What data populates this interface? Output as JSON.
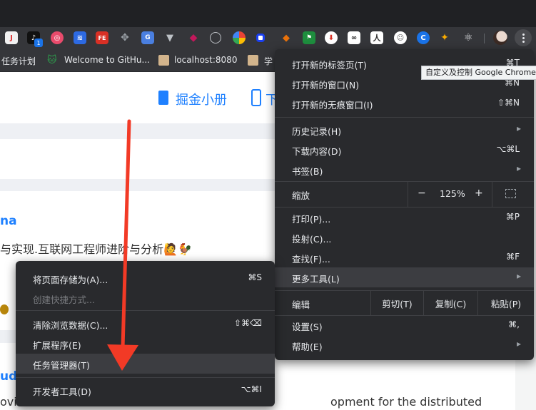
{
  "extensions": {
    "badge": "1",
    "icons": [
      "j-icon",
      "tiktok-icon",
      "pink-circle-icon",
      "layers-icon",
      "fe-icon",
      "move-icon",
      "translate-icon",
      "vue-icon",
      "diamond-icon",
      "speedometer-icon",
      "colorful-ball-icon",
      "blue-square-icon",
      "orange-icon",
      "green-flag-icon",
      "download-icon",
      "glasses-icon",
      "person-icon",
      "ghost-icon",
      "blue-c-icon",
      "dog-icon",
      "react-icon"
    ]
  },
  "bookmarks": {
    "items": [
      {
        "label": "任务计划"
      },
      {
        "label": "Welcome to GitHu..."
      },
      {
        "label": "localhost:8080"
      },
      {
        "label": "学"
      }
    ]
  },
  "page": {
    "header_link": "掘金小册",
    "header_link2": "下",
    "article_title_fragment": "na",
    "article_body_fragment": "与实现.互联网工程师进阶与分析🙋🐓",
    "article2_title_fragment": "ud-",
    "article2_body_fragment": "ovid",
    "article2_body_right": "opment for the distributed"
  },
  "tooltip": "自定义及控制 Google Chrome",
  "menu": {
    "new_tab": {
      "label": "打开新的标签页(T)",
      "shortcut": "⌘T"
    },
    "new_window": {
      "label": "打开新的窗口(N)",
      "shortcut": "⌘N"
    },
    "incognito": {
      "label": "打开新的无痕窗口(I)",
      "shortcut": "⇧⌘N"
    },
    "history": {
      "label": "历史记录(H)"
    },
    "downloads": {
      "label": "下载内容(D)",
      "shortcut": "⌥⌘L"
    },
    "bookmarks": {
      "label": "书签(B)"
    },
    "zoom": {
      "label": "缩放",
      "minus": "−",
      "value": "125%",
      "plus": "+"
    },
    "print": {
      "label": "打印(P)...",
      "shortcut": "⌘P"
    },
    "cast": {
      "label": "投射(C)..."
    },
    "find": {
      "label": "查找(F)...",
      "shortcut": "⌘F"
    },
    "more_tools": {
      "label": "更多工具(L)"
    },
    "edit": {
      "label": "编辑",
      "cut": "剪切(T)",
      "copy": "复制(C)",
      "paste": "粘贴(P)"
    },
    "settings": {
      "label": "设置(S)",
      "shortcut": "⌘,"
    },
    "help": {
      "label": "帮助(E)"
    }
  },
  "submenu": {
    "save_page": {
      "label": "将页面存储为(A)...",
      "shortcut": "⌘S"
    },
    "create_shortcut": {
      "label": "创建快捷方式..."
    },
    "clear_data": {
      "label": "清除浏览数据(C)...",
      "shortcut": "⇧⌘⌫"
    },
    "extensions": {
      "label": "扩展程序(E)"
    },
    "task_manager": {
      "label": "任务管理器(T)"
    },
    "dev_tools": {
      "label": "开发者工具(D)",
      "shortcut": "⌥⌘I"
    }
  },
  "colors": {
    "accent_blue": "#1e80ff",
    "arrow_red": "#f23a26",
    "menu_bg": "#292a2d"
  }
}
